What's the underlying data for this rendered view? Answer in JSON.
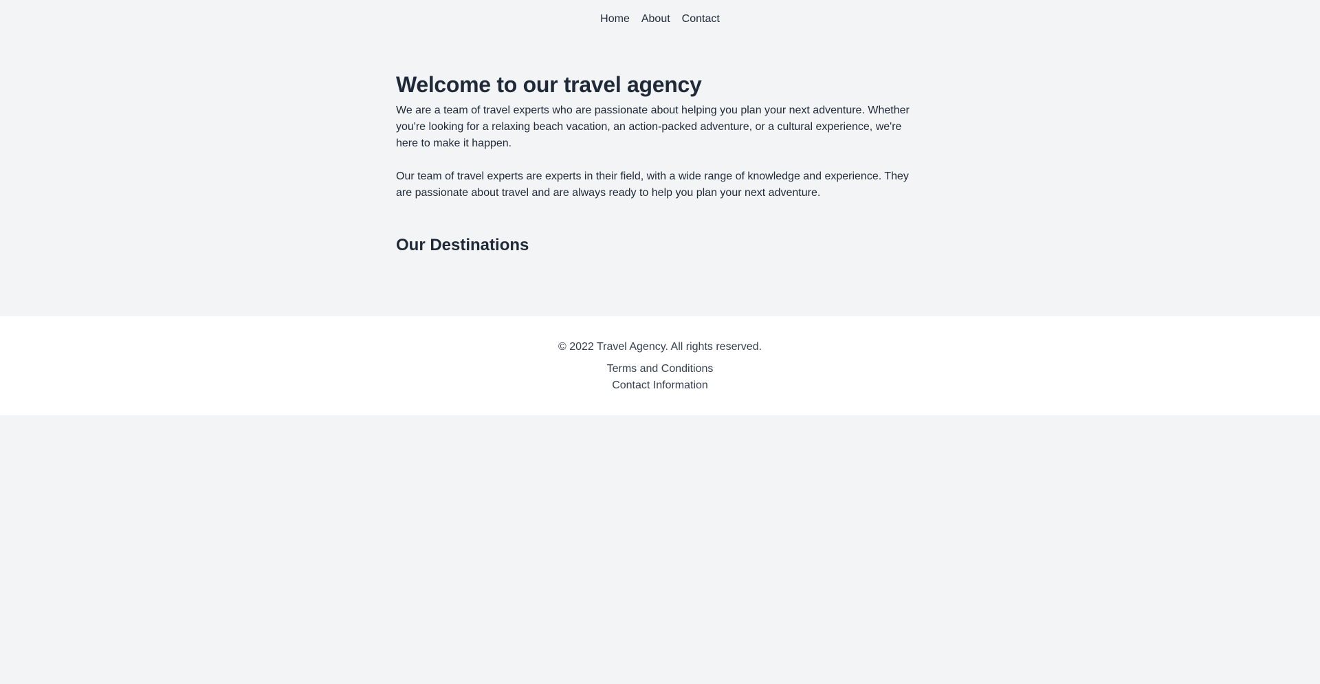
{
  "nav": {
    "items": [
      {
        "label": "Home"
      },
      {
        "label": "About"
      },
      {
        "label": "Contact"
      }
    ]
  },
  "main": {
    "title": "Welcome to our travel agency",
    "paragraphs": [
      "We are a team of travel experts who are passionate about helping you plan your next adventure. Whether you're looking for a relaxing beach vacation, an action-packed adventure, or a cultural experience, we're here to make it happen.",
      "Our team of travel experts are experts in their field, with a wide range of knowledge and experience. They are passionate about travel and are always ready to help you plan your next adventure."
    ],
    "destinations_title": "Our Destinations"
  },
  "footer": {
    "copyright": "© 2022 Travel Agency. All rights reserved.",
    "links": [
      {
        "label": "Terms and Conditions"
      },
      {
        "label": "Contact Information"
      }
    ]
  },
  "colors": {
    "page_background": "#f3f4f6",
    "footer_background": "#ffffff",
    "text": "#1f2937",
    "footer_text": "#374151"
  }
}
